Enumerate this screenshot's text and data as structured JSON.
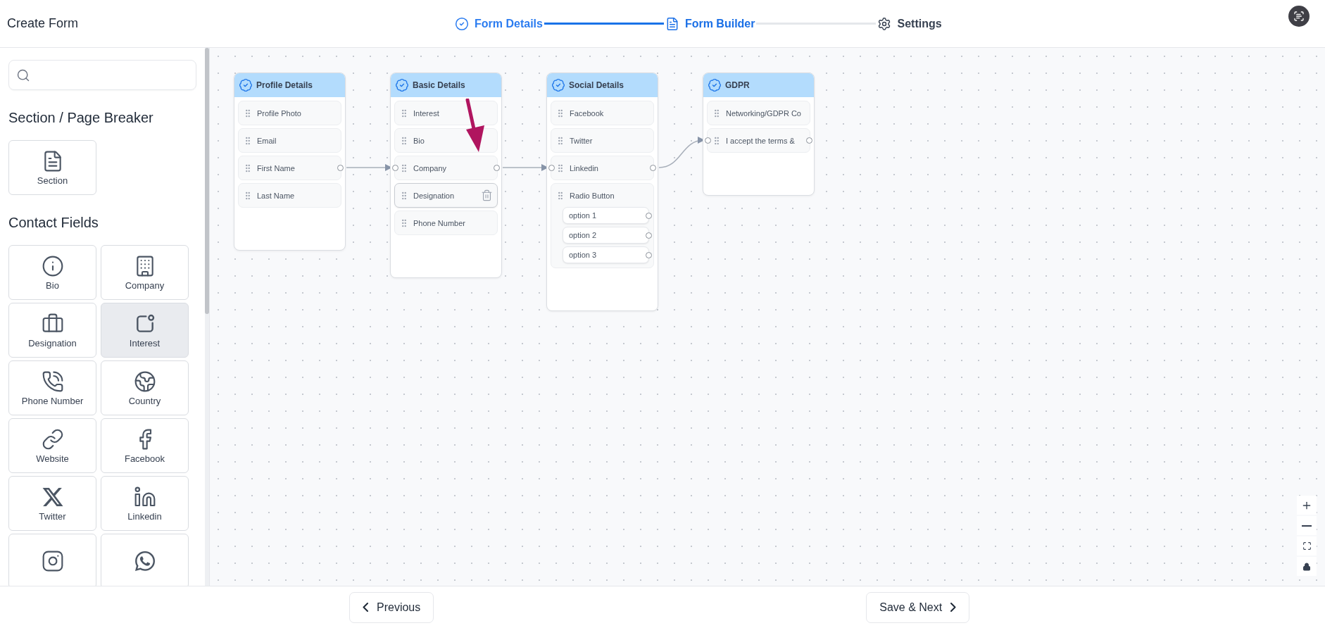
{
  "header": {
    "title": "Create Form",
    "steps": [
      {
        "label": "Form Details",
        "done": true,
        "selected": false
      },
      {
        "label": "Form Builder",
        "done": false,
        "selected": true
      },
      {
        "label": "Settings",
        "done": false,
        "selected": false
      }
    ]
  },
  "sidebar": {
    "sections": [
      {
        "title": "Section / Page Breaker",
        "items": [
          {
            "label": "Section",
            "kind": "document",
            "selected": false
          }
        ]
      },
      {
        "title": "Contact Fields",
        "items": [
          {
            "label": "Bio",
            "kind": "info",
            "selected": false
          },
          {
            "label": "Company",
            "kind": "building",
            "selected": false
          },
          {
            "label": "Designation",
            "kind": "briefcase",
            "selected": false
          },
          {
            "label": "Interest",
            "kind": "interest",
            "selected": true
          },
          {
            "label": "Phone Number",
            "kind": "phone",
            "selected": false
          },
          {
            "label": "Country",
            "kind": "globe",
            "selected": false
          },
          {
            "label": "Website",
            "kind": "link",
            "selected": false
          },
          {
            "label": "Facebook",
            "kind": "facebook",
            "selected": false
          },
          {
            "label": "Twitter",
            "kind": "x",
            "selected": false
          },
          {
            "label": "Linkedin",
            "kind": "linkedin",
            "selected": false
          },
          {
            "kind": "instagram",
            "selected": false
          },
          {
            "kind": "whatsapp",
            "selected": false
          }
        ]
      }
    ]
  },
  "canvas": {
    "nodes": [
      {
        "title": "Profile Details",
        "items": [
          {
            "label": "Profile Photo",
            "kind": "field",
            "selected": false,
            "in": false,
            "out": false
          },
          {
            "label": "Email",
            "kind": "field",
            "selected": false,
            "in": false,
            "out": false
          },
          {
            "label": "First Name",
            "kind": "field",
            "selected": false,
            "in": false,
            "out": true
          },
          {
            "label": "Last Name",
            "kind": "field",
            "selected": false,
            "in": false,
            "out": false
          }
        ]
      },
      {
        "title": "Basic Details",
        "items": [
          {
            "label": "Interest",
            "kind": "field",
            "selected": false,
            "in": false,
            "out": false
          },
          {
            "label": "Bio",
            "kind": "field",
            "selected": false,
            "in": false,
            "out": false
          },
          {
            "label": "Company",
            "kind": "field",
            "selected": false,
            "in": true,
            "out": true
          },
          {
            "label": "Designation",
            "kind": "field",
            "selected": true,
            "in": false,
            "out": false
          },
          {
            "label": "Phone Number",
            "kind": "field",
            "selected": false,
            "in": false,
            "out": false
          }
        ]
      },
      {
        "title": "Social Details",
        "items": [
          {
            "label": "Facebook",
            "kind": "field",
            "selected": false,
            "in": false,
            "out": false
          },
          {
            "label": "Twitter",
            "kind": "field",
            "selected": false,
            "in": false,
            "out": false
          },
          {
            "label": "Linkedin",
            "kind": "field",
            "selected": false,
            "in": true,
            "out": true
          },
          {
            "label": "Radio Button",
            "kind": "radio",
            "selected": false,
            "in": false,
            "out": false,
            "options": [
              "option 1",
              "option 2",
              "option 3"
            ]
          }
        ]
      },
      {
        "title": "GDPR",
        "items": [
          {
            "label": "Networking/GDPR Co",
            "kind": "field",
            "selected": false,
            "in": false,
            "out": false
          },
          {
            "label": "I accept the terms &",
            "kind": "field",
            "selected": false,
            "in": true,
            "out": true
          }
        ]
      }
    ],
    "annotation": {
      "kind": "arrow"
    },
    "controls": [
      {
        "kind": "zoom-in"
      },
      {
        "kind": "zoom-out"
      },
      {
        "kind": "fit"
      },
      {
        "kind": "lock"
      }
    ]
  },
  "footer": {
    "buttons": [
      {
        "label": "Previous",
        "kind": "back"
      },
      {
        "label": "Save & Next",
        "kind": "next"
      }
    ]
  }
}
